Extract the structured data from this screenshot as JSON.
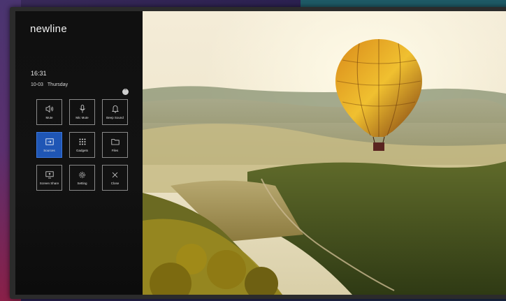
{
  "brand": "newline",
  "clock": {
    "time": "16:31",
    "date": "10-03",
    "weekday": "Thursday"
  },
  "collapse_icon": "chevron-up-icon",
  "tiles": [
    {
      "label": "Mute",
      "icon": "speaker-icon",
      "active": false
    },
    {
      "label": "Mic Mute",
      "icon": "microphone-icon",
      "active": false
    },
    {
      "label": "Beep Sound",
      "icon": "bell-icon",
      "active": false
    },
    {
      "label": "Sources",
      "icon": "input-source-icon",
      "active": true
    },
    {
      "label": "Gadgets",
      "icon": "grid-dots-icon",
      "active": false
    },
    {
      "label": "Files",
      "icon": "folder-icon",
      "active": false
    },
    {
      "label": "Screen Share",
      "icon": "screen-share-icon",
      "active": false
    },
    {
      "label": "Setting",
      "icon": "gear-icon",
      "active": false
    },
    {
      "label": "Close",
      "icon": "close-icon",
      "active": false
    }
  ],
  "colors": {
    "accent": "#1f56b5",
    "sidebar": "#111111"
  }
}
